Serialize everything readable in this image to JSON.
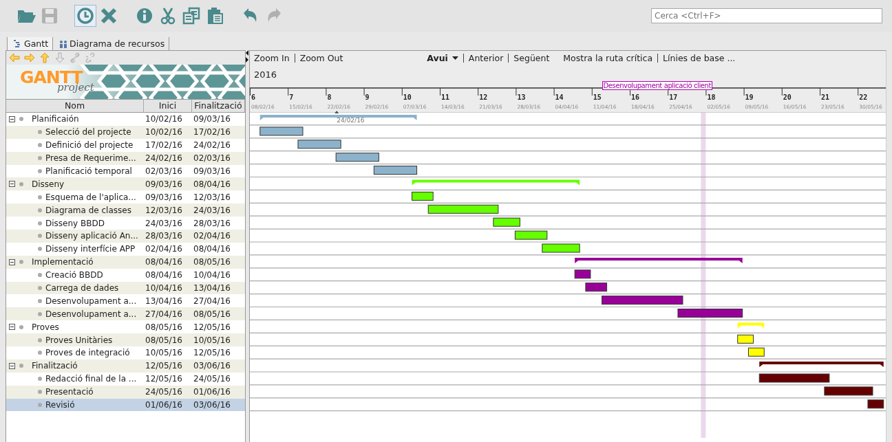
{
  "toolbar": {
    "buttons": [
      {
        "kind": "open",
        "disabled": false,
        "active": false
      },
      {
        "kind": "save",
        "disabled": true,
        "active": false
      },
      {
        "kind": "clock",
        "disabled": false,
        "active": true
      },
      {
        "kind": "delete",
        "disabled": false,
        "active": false
      },
      {
        "kind": "info",
        "disabled": false,
        "active": false
      },
      {
        "kind": "cut",
        "disabled": false,
        "active": false
      },
      {
        "kind": "copy",
        "disabled": false,
        "active": false
      },
      {
        "kind": "paste",
        "disabled": false,
        "active": false
      },
      {
        "kind": "undo",
        "disabled": false,
        "active": false
      },
      {
        "kind": "redo",
        "disabled": true,
        "active": false
      }
    ],
    "search": {
      "placeholder": "Cerca <Ctrl+F>"
    }
  },
  "tabs": [
    {
      "label": "Gantt",
      "kind": "gantt",
      "selected": true
    },
    {
      "label": "Diagrama de recursos",
      "kind": "people",
      "selected": false
    }
  ],
  "tree": {
    "nav": [
      {
        "kind": "left",
        "disabled": false
      },
      {
        "kind": "right",
        "disabled": false
      },
      {
        "kind": "up",
        "disabled": false
      },
      {
        "kind": "down",
        "disabled": true
      },
      {
        "kind": "link",
        "disabled": true
      },
      {
        "kind": "unlink",
        "disabled": true
      }
    ],
    "logo": {
      "title": "GANTT",
      "subtitle": "project"
    },
    "columns": [
      "Nom",
      "Inici",
      "Finalització"
    ],
    "rows": [
      {
        "name": "Planificaión",
        "start": "10/02/16",
        "end": "09/03/16",
        "expanded": true,
        "selected": false,
        "color": "#8db3cc",
        "note": "24/02/16",
        "children": [
          {
            "name": "Selecció del projecte",
            "start": "10/02/16",
            "end": "17/02/16",
            "selected": false
          },
          {
            "name": "Definició del projecte",
            "start": "17/02/16",
            "end": "24/02/16",
            "selected": false
          },
          {
            "name": "Presa de Requerime...",
            "start": "24/02/16",
            "end": "02/03/16",
            "selected": false
          },
          {
            "name": "Planificació temporal",
            "start": "02/03/16",
            "end": "09/03/16",
            "selected": false
          }
        ]
      },
      {
        "name": "Disseny",
        "start": "09/03/16",
        "end": "08/04/16",
        "expanded": true,
        "selected": false,
        "color": "#66ff00",
        "children": [
          {
            "name": "Esquema de l'aplica...",
            "start": "09/03/16",
            "end": "12/03/16",
            "selected": false
          },
          {
            "name": "Diagrama de classes",
            "start": "12/03/16",
            "end": "24/03/16",
            "selected": false
          },
          {
            "name": "Disseny BBDD",
            "start": "24/03/16",
            "end": "28/03/16",
            "selected": false
          },
          {
            "name": "Disseny aplicació An...",
            "start": "28/03/16",
            "end": "02/04/16",
            "selected": false
          },
          {
            "name": "Disseny interfície APP",
            "start": "02/04/16",
            "end": "08/04/16",
            "selected": false
          }
        ]
      },
      {
        "name": "Implementació",
        "start": "08/04/16",
        "end": "08/05/16",
        "expanded": true,
        "selected": false,
        "color": "#990099",
        "children": [
          {
            "name": "Creació BBDD",
            "start": "08/04/16",
            "end": "10/04/16",
            "selected": false
          },
          {
            "name": "Carrega de dades",
            "start": "10/04/16",
            "end": "13/04/16",
            "selected": false
          },
          {
            "name": "Desenvolupament a...",
            "start": "13/04/16",
            "end": "27/04/16",
            "selected": false,
            "tooltip": "Desenvolupament aplicació client"
          },
          {
            "name": "Desenvolupament a...",
            "start": "27/04/16",
            "end": "08/05/16",
            "selected": false
          }
        ]
      },
      {
        "name": "Proves",
        "start": "08/05/16",
        "end": "12/05/16",
        "expanded": true,
        "selected": false,
        "color": "#ffff00",
        "children": [
          {
            "name": "Proves Unitàries",
            "start": "08/05/16",
            "end": "10/05/16",
            "selected": false
          },
          {
            "name": "Proves de integració",
            "start": "10/05/16",
            "end": "12/05/16",
            "selected": false
          }
        ]
      },
      {
        "name": "Finalització",
        "start": "12/05/16",
        "end": "03/06/16",
        "expanded": true,
        "selected": false,
        "color": "#660000",
        "children": [
          {
            "name": "Redacció final de la ...",
            "start": "12/05/16",
            "end": "24/05/16",
            "selected": false
          },
          {
            "name": "Presentació",
            "start": "24/05/16",
            "end": "01/06/16",
            "selected": false
          },
          {
            "name": "Revisió",
            "start": "01/06/16",
            "end": "03/06/16",
            "selected": true
          }
        ]
      }
    ]
  },
  "chart": {
    "action_groups": [
      {
        "items": [
          {
            "label": "Zoom In",
            "kind": "link"
          },
          {
            "label": "Zoom Out",
            "kind": "link"
          }
        ]
      },
      {
        "items": [
          {
            "label": "Avui",
            "kind": "dropdown"
          },
          {
            "label": "Anterior",
            "kind": "link"
          },
          {
            "label": "Següent",
            "kind": "link"
          }
        ]
      },
      {
        "items": [
          {
            "label": "Mostra la ruta crítica",
            "kind": "link"
          },
          {
            "label": "Línies de base ...",
            "kind": "link"
          }
        ]
      }
    ],
    "year": "2016",
    "weeks": [
      {
        "number": "6",
        "date": "08/02/16",
        "current": false
      },
      {
        "number": "7",
        "date": "15/02/16",
        "current": false
      },
      {
        "number": "8",
        "date": "22/02/16",
        "current": false
      },
      {
        "number": "9",
        "date": "29/02/16",
        "current": false
      },
      {
        "number": "10",
        "date": "07/03/16",
        "current": false
      },
      {
        "number": "11",
        "date": "14/03/16",
        "current": false
      },
      {
        "number": "12",
        "date": "21/03/16",
        "current": false
      },
      {
        "number": "13",
        "date": "28/03/16",
        "current": false
      },
      {
        "number": "14",
        "date": "04/04/16",
        "current": false
      },
      {
        "number": "15",
        "date": "11/04/16",
        "current": false
      },
      {
        "number": "16",
        "date": "18/04/16",
        "current": false
      },
      {
        "number": "17",
        "date": "25/04/16",
        "current": false
      },
      {
        "number": "18",
        "date": "02/05/16",
        "current": true
      },
      {
        "number": "19",
        "date": "09/05/16",
        "current": false
      },
      {
        "number": "20",
        "date": "16/05/16",
        "current": false
      },
      {
        "number": "21",
        "date": "23/05/16",
        "current": false
      },
      {
        "number": "22",
        "date": "30/05/16",
        "current": false
      }
    ]
  }
}
